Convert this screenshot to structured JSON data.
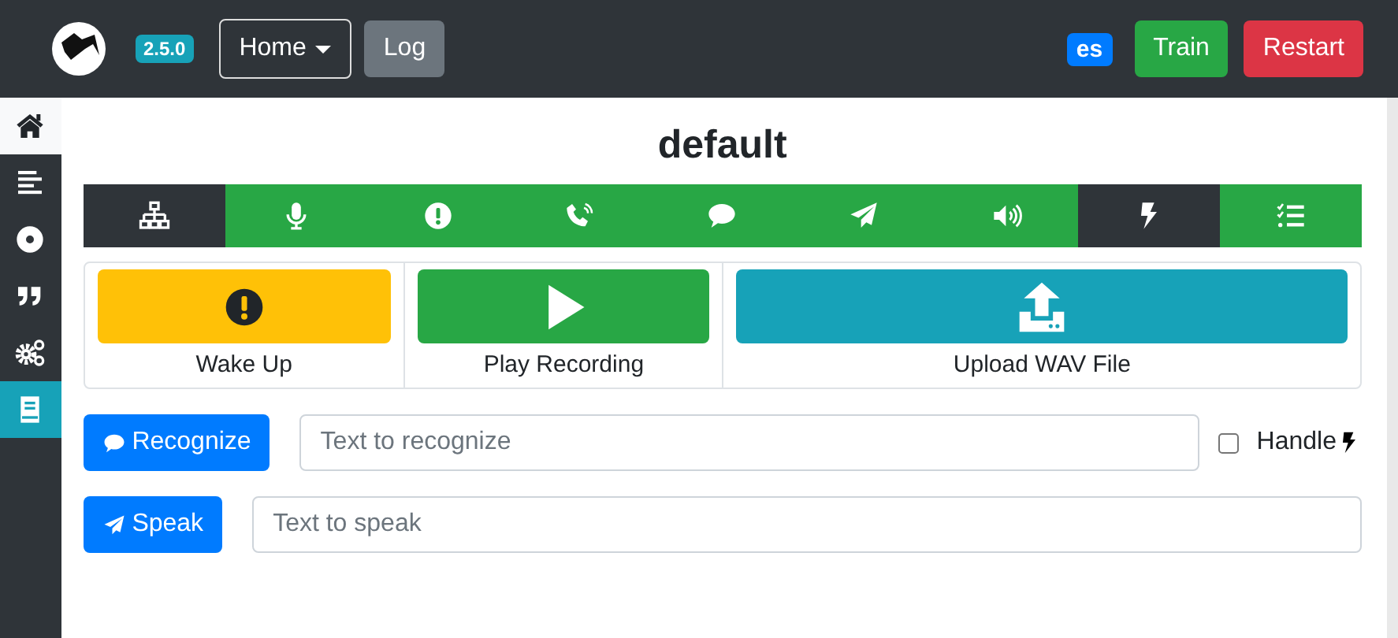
{
  "navbar": {
    "version": "2.5.0",
    "menu": "Home",
    "log_button": "Log",
    "language": "es",
    "train_button": "Train",
    "restart_button": "Restart"
  },
  "sidebar": {
    "items": [
      {
        "kind": "home",
        "selected": true,
        "active": false
      },
      {
        "kind": "lines",
        "selected": false,
        "active": false
      },
      {
        "kind": "disc",
        "selected": false,
        "active": false
      },
      {
        "kind": "quote",
        "selected": false,
        "active": false
      },
      {
        "kind": "gears",
        "selected": false,
        "active": false
      },
      {
        "kind": "book",
        "selected": false,
        "active": true
      }
    ]
  },
  "title": "default",
  "tabs": [
    {
      "kind": "network",
      "selected": true
    },
    {
      "kind": "mic",
      "selected": false
    },
    {
      "kind": "alert",
      "selected": false
    },
    {
      "kind": "phone",
      "selected": false
    },
    {
      "kind": "chat",
      "selected": false
    },
    {
      "kind": "plane",
      "selected": false
    },
    {
      "kind": "volume",
      "selected": false
    },
    {
      "kind": "bolt",
      "selected": true
    },
    {
      "kind": "checklist",
      "selected": false
    }
  ],
  "actions": [
    {
      "kind": "warning",
      "label": "Wake Up"
    },
    {
      "kind": "success",
      "label": "Play Recording"
    },
    {
      "kind": "info",
      "label": "Upload WAV File"
    }
  ],
  "recognize": {
    "button": "Recognize",
    "placeholder": "Text to recognize",
    "handle_checked": false,
    "handle_label": "Handle"
  },
  "speak": {
    "button": "Speak",
    "placeholder": "Text to speak"
  }
}
